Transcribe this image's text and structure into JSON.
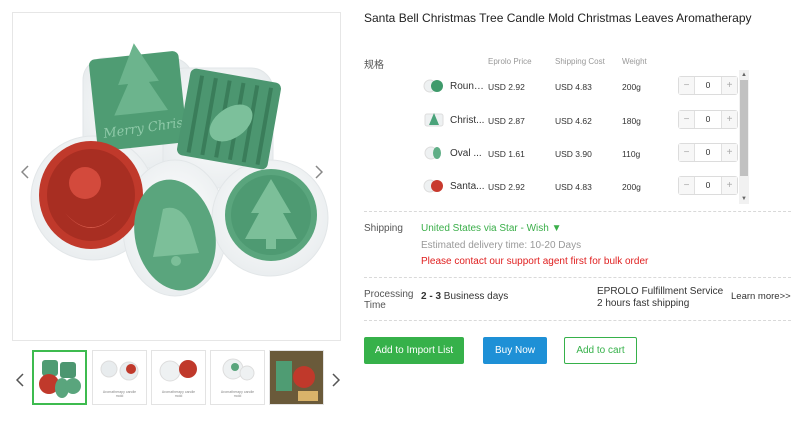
{
  "product": {
    "title": "Santa Bell Christmas Tree Candle Mold Christmas Leaves Aromatherapy"
  },
  "gallery": {
    "main_image_alt": "silicone candle molds",
    "mold_text": "Merry Christmas",
    "thumbnails": [
      {
        "caption": ""
      },
      {
        "caption": "Aromatherapy candle mold"
      },
      {
        "caption": "Aromatherapy candle mold"
      },
      {
        "caption": "Aromatherapy candle mold"
      },
      {
        "caption": ""
      }
    ]
  },
  "variants_table": {
    "label": "规格",
    "columns": {
      "price": "Eprolo Price",
      "shipping": "Shipping Cost",
      "weight": "Weight"
    },
    "rows": [
      {
        "name": "Round...",
        "price": "USD 2.92",
        "shipping": "USD 4.83",
        "weight": "200g",
        "qty": "0",
        "color": "#3f9a6b"
      },
      {
        "name": "Christ...",
        "price": "USD 2.87",
        "shipping": "USD 4.62",
        "weight": "180g",
        "qty": "0",
        "color": "#4aa37a"
      },
      {
        "name": "Oval ...",
        "price": "USD 1.61",
        "shipping": "USD 3.90",
        "weight": "110g",
        "qty": "0",
        "color": "#5fae86"
      },
      {
        "name": "Santa...",
        "price": "USD 2.92",
        "shipping": "USD 4.83",
        "weight": "200g",
        "qty": "0",
        "color": "#c83a2e"
      }
    ],
    "minus": "−",
    "plus": "+"
  },
  "shipping": {
    "label": "Shipping",
    "method": "United States via Star - Wish ▼",
    "eta": "Estimated delivery time: 10-20 Days",
    "warning": "Please contact our support agent first for bulk order"
  },
  "processing": {
    "label": "Processing Time",
    "days_range": "2 - 3",
    "days_unit": "Business days",
    "service_line1": "EPROLO Fulfillment Service",
    "service_line2": "2 hours fast shipping",
    "learn_more": "Learn more>>"
  },
  "actions": {
    "import": "Add to Import List",
    "buy": "Buy Now",
    "cart": "Add to cart"
  },
  "colors": {
    "green": "#36b14a",
    "blue": "#1e90d6",
    "red": "#e02020",
    "mold_green": "#4f9c73",
    "mold_red": "#c0392b"
  }
}
